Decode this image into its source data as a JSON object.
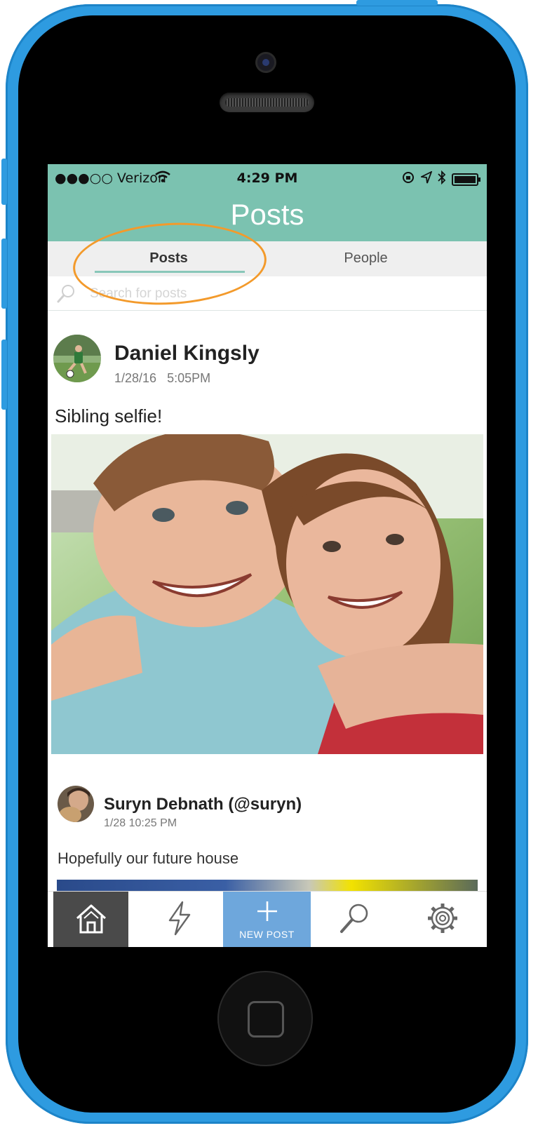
{
  "status_bar": {
    "carrier": "●●●○○ Verizon",
    "time": "4:29 PM"
  },
  "nav": {
    "title": "Posts"
  },
  "tabs": [
    {
      "label": "Posts",
      "active": true
    },
    {
      "label": "People",
      "active": false
    }
  ],
  "search": {
    "placeholder": "Search for posts"
  },
  "posts": [
    {
      "author": "Daniel Kingsly",
      "date": "1/28/16",
      "time": "5:05PM",
      "caption": "Sibling selfie!"
    },
    {
      "author": "Suryn Debnath (@suryn)",
      "date": "1/28 10:25 PM",
      "caption": "Hopefully our future house"
    }
  ],
  "tabbar": {
    "new_post_label": "NEW POST"
  },
  "colors": {
    "header": "#7bc2b0",
    "new_post": "#6ea7dc",
    "phone_body": "#2e9be0",
    "annotation": "#f39a2b"
  }
}
